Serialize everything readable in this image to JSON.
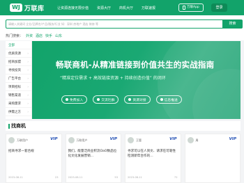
{
  "header": {
    "logo_mark": "WJ",
    "logo_text": "万联库",
    "nav": [
      "让资源连接无限价值",
      "资源大厅",
      "商机大厅",
      "万联速报"
    ],
    "app_button": "万联App",
    "login": "登录"
  },
  "search": {
    "placeholder": "请输入关键词 企业/品牌名/产品/服务/行业 如：深圳 房地产 酒店 装修 等",
    "button": "搜索",
    "hot_label": "热门搜索：",
    "hot_tags": [
      "外资",
      "酒店",
      "快手",
      "山东"
    ]
  },
  "sidebar": {
    "items": [
      {
        "label": "全部"
      },
      {
        "label": "优质资源"
      },
      {
        "label": "招商加盟"
      },
      {
        "label": "寻找投资"
      },
      {
        "label": "广告平台"
      },
      {
        "label": "项目招标"
      },
      {
        "label": "销售渠道"
      },
      {
        "label": "采购需求"
      },
      {
        "label": "供需之方"
      }
    ]
  },
  "banner": {
    "title": "畅联商机-从精准链接到价值共生的实战指南",
    "subtitle": "“精准定位需求 + 高效链接资源 + 持续创造价值” 的闭环",
    "pills": [
      "免费加入",
      "交流社群",
      "资源对接",
      "信息推送"
    ]
  },
  "section": {
    "title": "找商机"
  },
  "cards": [
    {
      "name": "万联用户",
      "vip": "VIP",
      "text": "招商寻求一套合规",
      "date": "2023-08-11",
      "count": "23"
    },
    {
      "name": "万联用户",
      "vip": "VIP",
      "text": "我们，能量泛商业积流OaO数品位化文化发展营销…",
      "date": "2023-08-11",
      "count": "53"
    },
    {
      "name": "王管",
      "vip": "VIP",
      "text": "寻求可以在人资文、请求在可靠性检测新年合作的…",
      "date": "2023-08-11",
      "count": "72"
    },
    {
      "name": "周",
      "vip": "VIP",
      "text": "",
      "date": "",
      "count": ""
    }
  ],
  "colors": {
    "brand": "#12a36a",
    "vip": "#1f4db3"
  }
}
